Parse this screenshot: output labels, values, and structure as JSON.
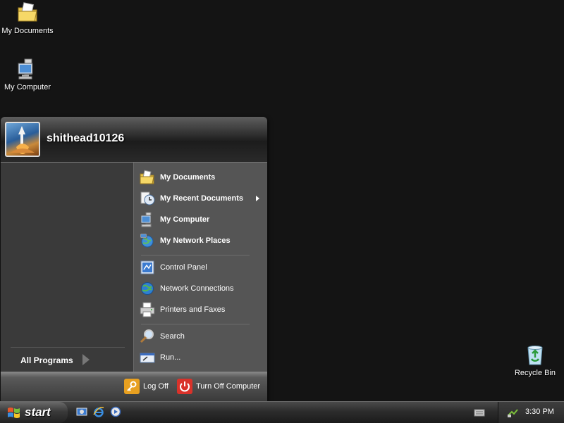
{
  "desktop": {
    "icons": [
      {
        "label": "My Documents",
        "icon": "my-documents-icon"
      },
      {
        "label": "My Computer",
        "icon": "my-computer-icon"
      },
      {
        "label": "Recycle Bin",
        "icon": "recycle-bin-icon"
      }
    ]
  },
  "start_menu": {
    "user_name": "shithead10126",
    "all_programs": "All Programs",
    "right_items": [
      {
        "label": "My Documents",
        "icon": "my-documents-icon"
      },
      {
        "label": "My Recent Documents",
        "icon": "recent-documents-icon"
      },
      {
        "label": "My Computer",
        "icon": "my-computer-icon"
      },
      {
        "label": "My Network Places",
        "icon": "network-places-icon"
      },
      {
        "label": "Control Panel",
        "icon": "control-panel-icon"
      },
      {
        "label": "Network Connections",
        "icon": "network-connections-icon"
      },
      {
        "label": "Printers and Faxes",
        "icon": "printers-faxes-icon"
      },
      {
        "label": "Search",
        "icon": "search-icon"
      },
      {
        "label": "Run...",
        "icon": "run-icon"
      }
    ],
    "log_off": "Log Off",
    "turn_off": "Turn Off Computer"
  },
  "taskbar": {
    "start_label": "start",
    "clock": "3:30 PM"
  },
  "colors": {
    "log_off_icon": "#e8a020",
    "turn_off_icon": "#d9322a"
  }
}
